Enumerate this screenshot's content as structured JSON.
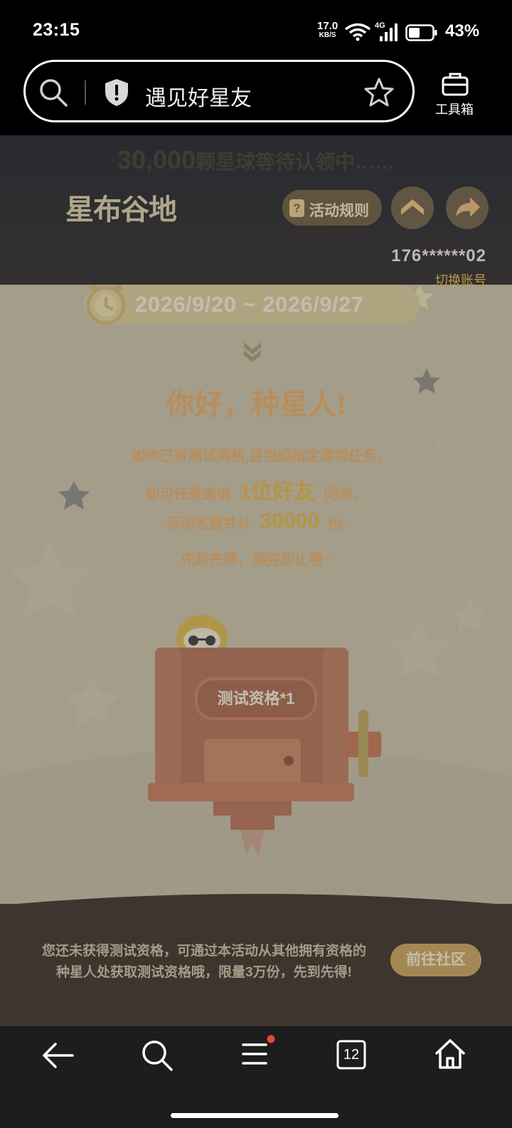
{
  "status_bar": {
    "time": "23:15",
    "net_speed": "17.0",
    "net_unit": "KB/S",
    "network": "4G",
    "battery": "43%"
  },
  "browser": {
    "url_title": "遇见好星友",
    "toolbox_label": "工具箱"
  },
  "page": {
    "tagline_num": "30,000",
    "tagline_text": "颗星球等待认领中……",
    "logo": "星布谷地",
    "rules_label": "活动规则",
    "phone": "176******02",
    "switch_account": "切换账号",
    "date_range": "2026/9/20 ~ 2026/9/27",
    "greeting": "你好，种星人!",
    "line1": "如你已有测试资格,且完成指定游戏任务,",
    "line2_pre": "即可任意邀请",
    "line2_hl": "1位好友",
    "line2_post": "同游。",
    "line3_pre": "活动名额共计",
    "line3_hl": "30000",
    "line3_post": "份,",
    "line4": "先到先得，领完即止哦~",
    "qualification": "测试资格*1",
    "notice_line1": "您还未获得测试资格，可通过本活动从其他拥有资格的",
    "notice_line2": "种星人处获取测试资格哦，限量3万份，先到先得!",
    "goto_button": "前往社区"
  },
  "nav": {
    "tab_count": "12"
  }
}
